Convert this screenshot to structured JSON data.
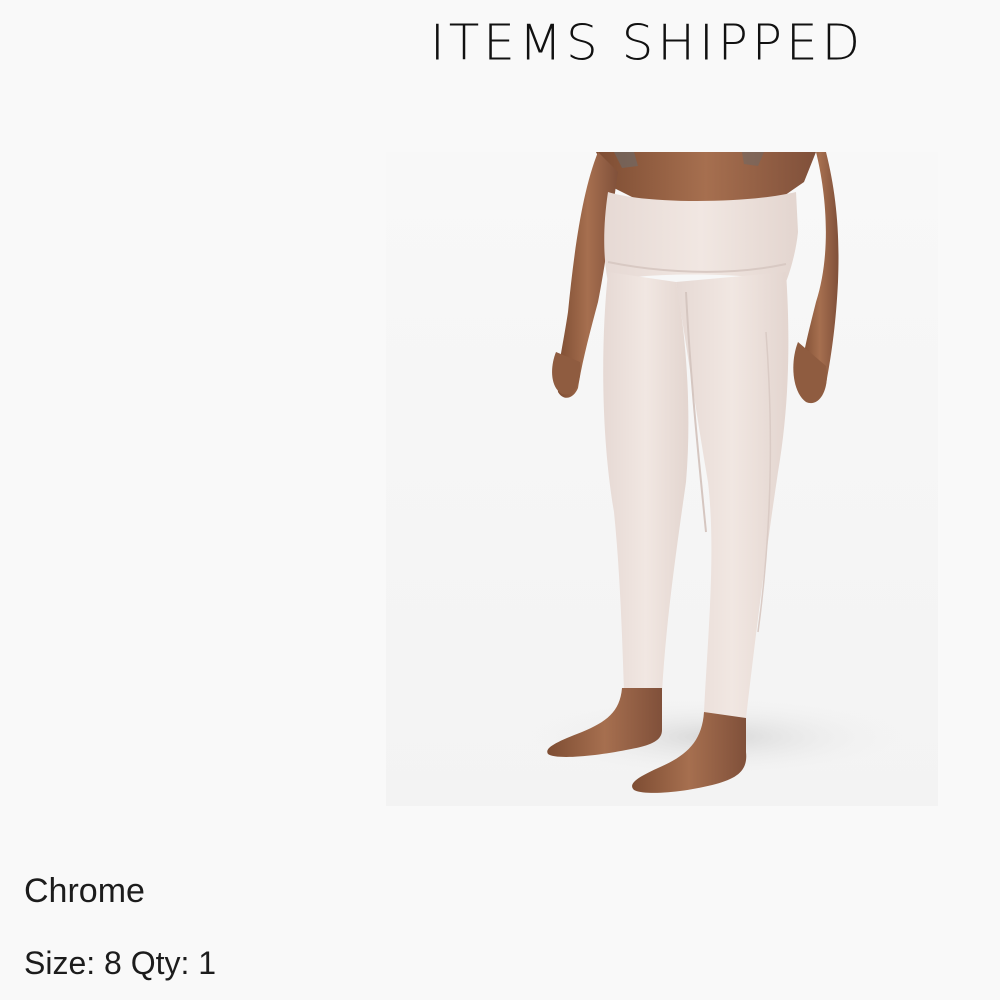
{
  "header": {
    "title": "ITEMS SHIPPED"
  },
  "item": {
    "image_alt": "leggings-product-photo",
    "color_name": "Chrome",
    "size_label": "Size:",
    "size_value": "8",
    "qty_label": "Qty:",
    "qty_value": "1"
  },
  "colors": {
    "background": "#f9f9f9",
    "leggings": "#efe4df",
    "skin": "#9a6446"
  }
}
